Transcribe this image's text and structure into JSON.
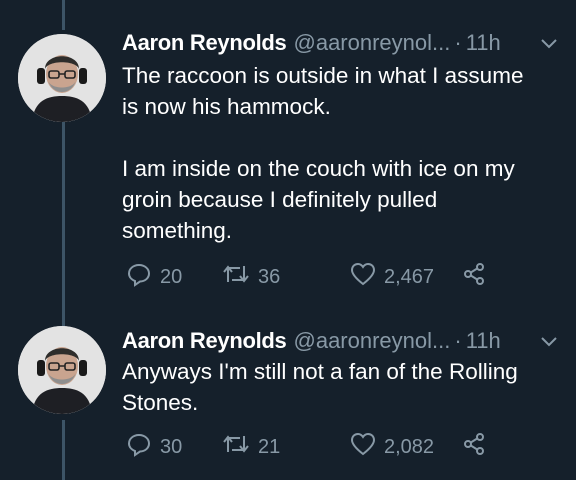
{
  "tweets": [
    {
      "display_name": "Aaron Reynolds",
      "handle": "@aaronreynol...",
      "separator": "·",
      "time": "11h",
      "text": "The raccoon is outside in what I assume\nis now his hammock.\n\nI am inside on the couch with ice on my\ngroin because I definitely pulled\nsomething.",
      "replies": "20",
      "retweets": "36",
      "likes": "2,467"
    },
    {
      "display_name": "Aaron Reynolds",
      "handle": "@aaronreynol...",
      "separator": "·",
      "time": "11h",
      "text": "Anyways I'm still not a fan of the Rolling\nStones.",
      "replies": "30",
      "retweets": "21",
      "likes": "2,082"
    }
  ],
  "icons": [
    "reply-icon",
    "retweet-icon",
    "like-icon",
    "share-icon",
    "chevron-down-icon"
  ],
  "colors": {
    "background": "#15202b",
    "secondary_text": "#8899a6",
    "thread_line": "#3d5466"
  }
}
